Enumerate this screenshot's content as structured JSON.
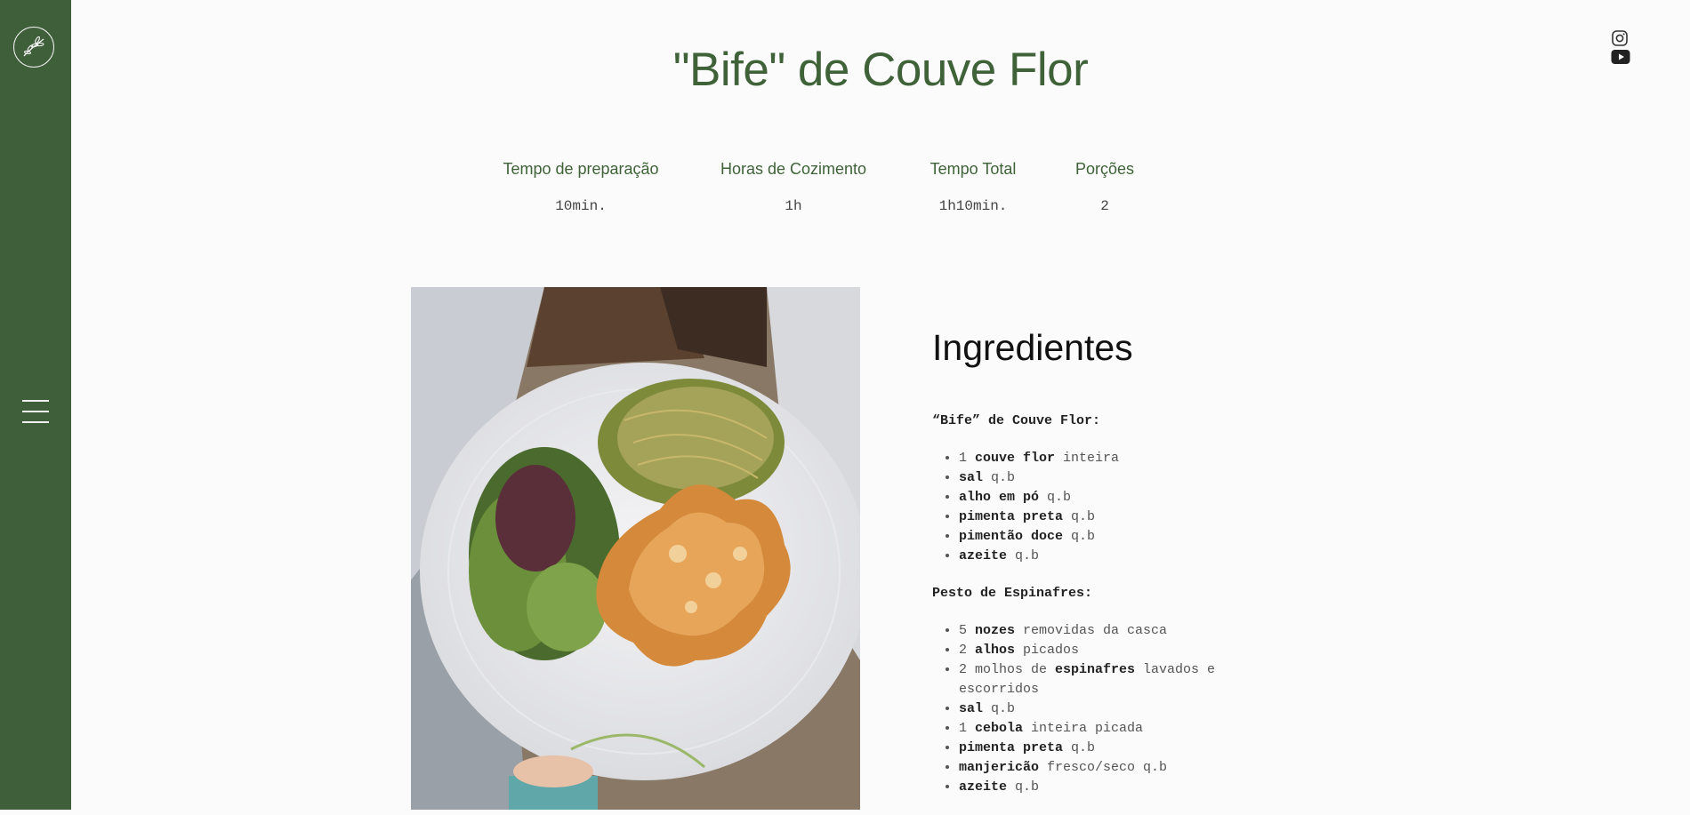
{
  "page": {
    "title": "\"Bife\" de Couve Flor"
  },
  "stats": [
    {
      "label": "Tempo de preparação",
      "value": "10min."
    },
    {
      "label": "Horas de Cozimento",
      "value": "1h"
    },
    {
      "label": "Tempo Total",
      "value": "1h10min."
    },
    {
      "label": "Porções",
      "value": "2"
    }
  ],
  "social": [
    "instagram-icon",
    "youtube-icon"
  ],
  "ingredients": {
    "heading": "Ingredientes",
    "sections": [
      {
        "title": "“Bife” de Couve Flor:",
        "items": [
          {
            "pre": "1 ",
            "bold": "couve flor",
            "post": " inteira"
          },
          {
            "pre": "",
            "bold": "sal",
            "post": " q.b"
          },
          {
            "pre": "",
            "bold": "alho em pó",
            "post": " q.b"
          },
          {
            "pre": "",
            "bold": "pimenta preta",
            "post": " q.b"
          },
          {
            "pre": "",
            "bold": "pimentão doce",
            "post": " q.b"
          },
          {
            "pre": "",
            "bold": "azeite",
            "post": " q.b"
          }
        ]
      },
      {
        "title": "Pesto de Espinafres:",
        "items": [
          {
            "pre": "5 ",
            "bold": "nozes",
            "post": " removidas da casca"
          },
          {
            "pre": "2 ",
            "bold": "alhos",
            "post": " picados"
          },
          {
            "pre": "2 molhos de ",
            "bold": "espinafres",
            "post": " lavados e escorridos"
          },
          {
            "pre": "",
            "bold": "sal",
            "post": " q.b"
          },
          {
            "pre": "1 ",
            "bold": "cebola",
            "post": " inteira picada"
          },
          {
            "pre": "",
            "bold": "pimenta preta",
            "post": " q.b"
          },
          {
            "pre": "",
            "bold": "manjericão",
            "post": " fresco/seco q.b"
          },
          {
            "pre": "",
            "bold": "azeite",
            "post": " q.b"
          }
        ]
      }
    ]
  },
  "colors": {
    "brand_green": "#3e5f39",
    "title_green": "#3f6239",
    "background": "#fbfbfb"
  }
}
